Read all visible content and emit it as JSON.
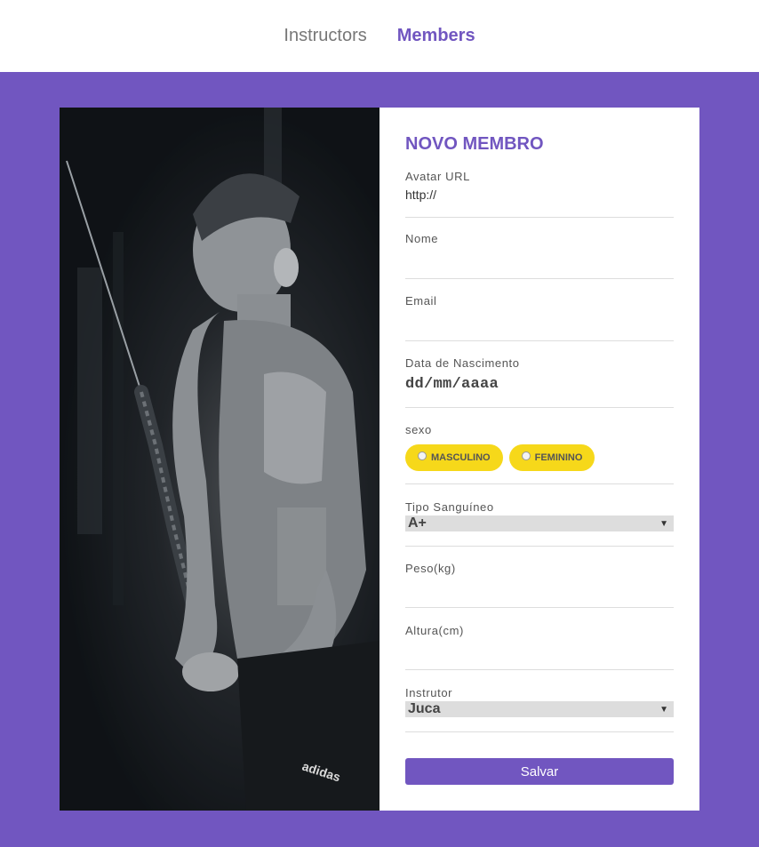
{
  "nav": {
    "items": [
      {
        "label": "Instructors",
        "active": false
      },
      {
        "label": "Members",
        "active": true
      }
    ]
  },
  "form": {
    "title": "NOVO MEMBRO",
    "fields": {
      "avatar": {
        "label": "Avatar URL",
        "value": "http://"
      },
      "name": {
        "label": "Nome",
        "value": ""
      },
      "email": {
        "label": "Email",
        "value": ""
      },
      "birth": {
        "label": "Data de Nascimento",
        "value": "dd/mm/aaaa"
      },
      "gender": {
        "label": "sexo",
        "options": [
          "MASCULINO",
          "FEMININO"
        ]
      },
      "blood": {
        "label": "Tipo Sanguíneo",
        "value": "A+"
      },
      "weight": {
        "label": "Peso(kg)",
        "value": ""
      },
      "height": {
        "label": "Altura(cm)",
        "value": ""
      },
      "instructor": {
        "label": "Instrutor",
        "value": "Juca"
      }
    },
    "submit_label": "Salvar"
  },
  "image": {
    "logo_text": "adidas"
  },
  "colors": {
    "brand": "#7156c0",
    "accent_yellow": "#f6d81a",
    "background": "#7156c0"
  }
}
